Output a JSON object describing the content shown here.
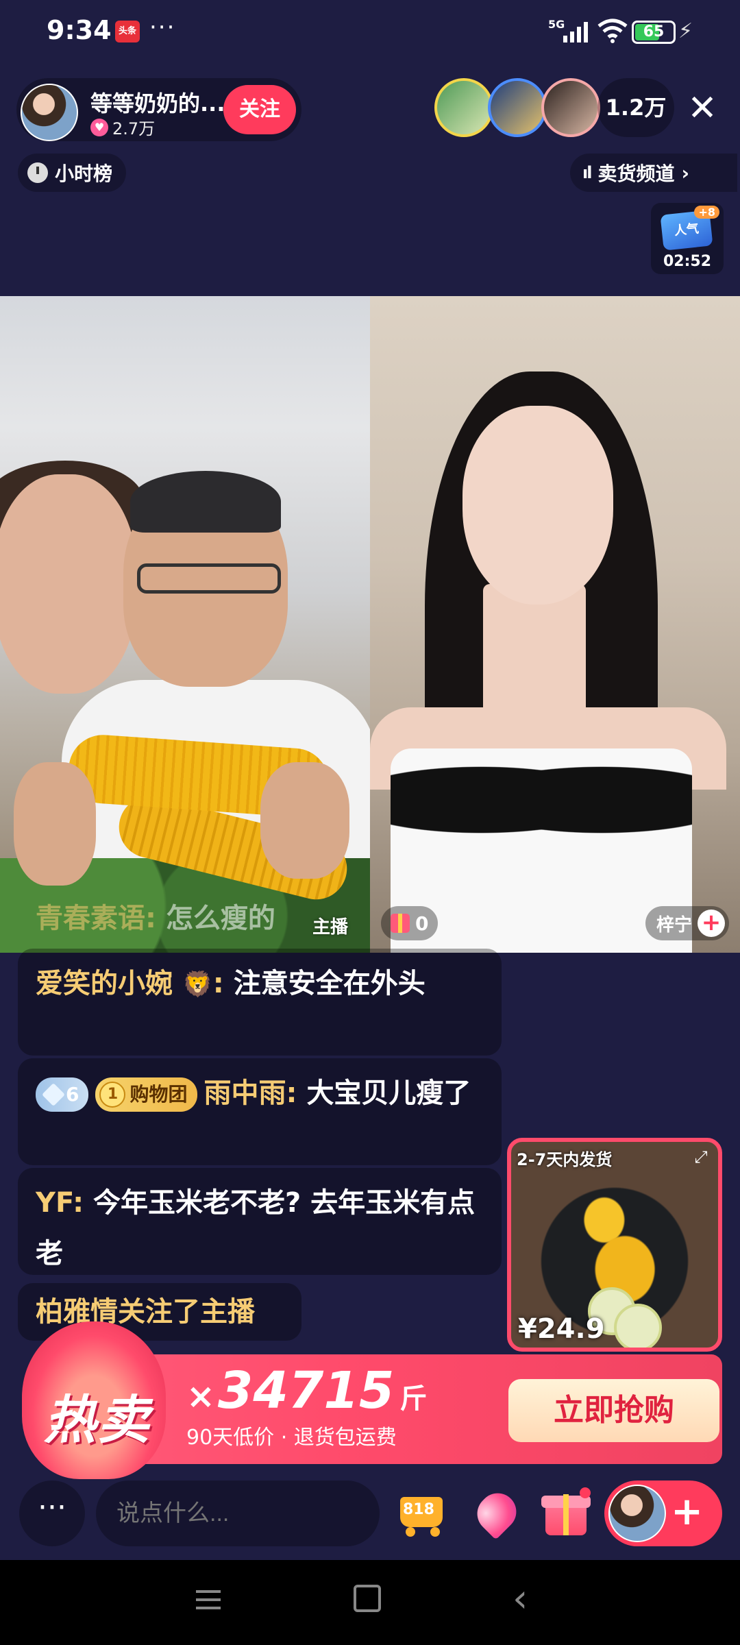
{
  "status_bar": {
    "time": "9:34",
    "news_badge": "头条",
    "dots": "···",
    "network": "5G",
    "battery": "65",
    "battery_level": 0.65
  },
  "host": {
    "name": "等等奶奶的...",
    "likes": "2.7万",
    "follow_label": "关注"
  },
  "viewers": {
    "count": "1.2万"
  },
  "hour_rank": "小时榜",
  "sell_channel": "卖货频道",
  "hot_badge": {
    "plus": "+8",
    "timer": "02:52",
    "label": "人气"
  },
  "video": {
    "host_tag": "主播",
    "gift_count": "0",
    "guest_name": "梓宁"
  },
  "comments": [
    {
      "user": "青春素语",
      "sep": ":",
      "text": "怎么瘦的"
    },
    {
      "user": "爱笑的小婉",
      "sep": ":",
      "text": "注意安全在外头"
    },
    {
      "level": "6",
      "group_level": "1",
      "group_label": "购物团",
      "user": "雨中雨",
      "sep": ":",
      "text": "大宝贝儿瘦了"
    },
    {
      "user": "YF",
      "sep": ":",
      "text": "今年玉米老不老? 去年玉米有点老"
    },
    {
      "user": "柏雅情",
      "text": "关注了主播"
    }
  ],
  "product": {
    "ship_time": "2-7天内发货",
    "price": "¥24.9"
  },
  "hot_sale": {
    "title": "热卖",
    "x": "×",
    "count": "34715",
    "unit": "斤",
    "subtitle": "90天低价 · 退货包运费",
    "buy_label": "立即抢购"
  },
  "bottom_bar": {
    "more": "···",
    "input_placeholder": "说点什么...",
    "cart_label": "818"
  }
}
